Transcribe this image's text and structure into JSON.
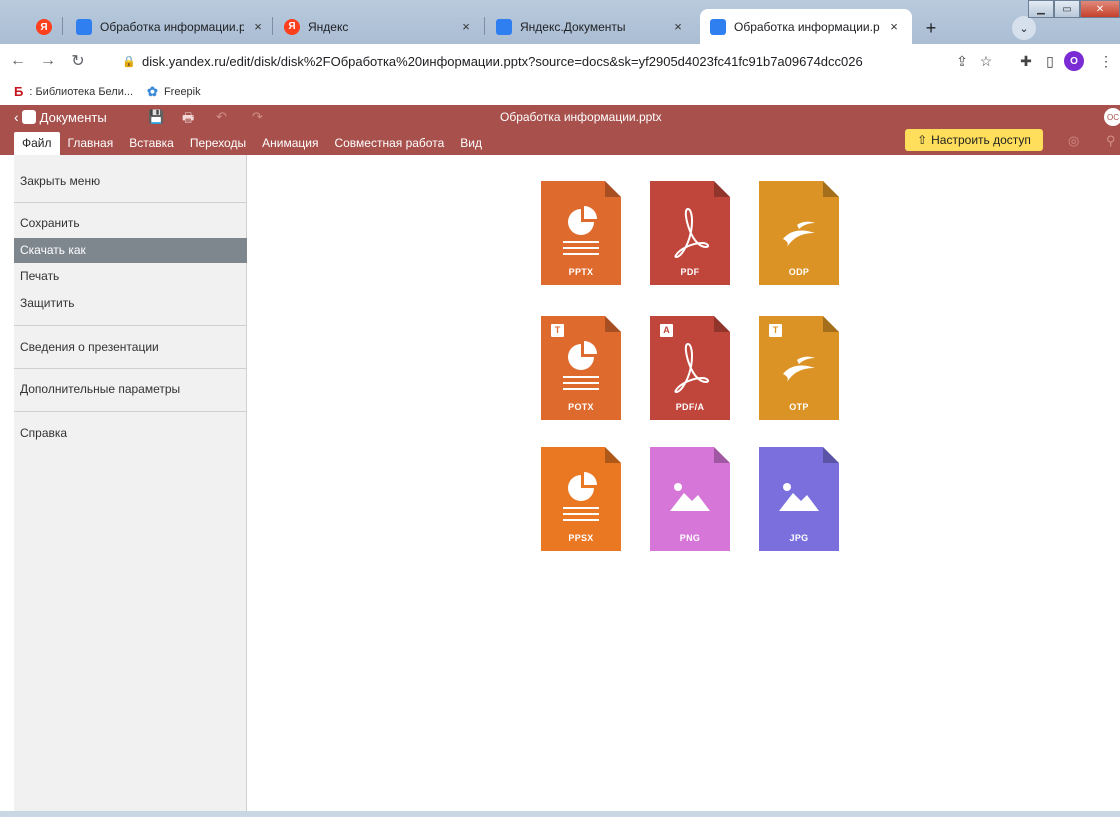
{
  "browser": {
    "tabs": [
      {
        "label": "Обработка информации.pptx -",
        "favicon": "yandex-docs-icon",
        "close": "×"
      },
      {
        "label": "Яндекс",
        "favicon": "yandex-icon",
        "close": "×"
      },
      {
        "label": "Яндекс.Документы",
        "favicon": "yandex-docs-icon",
        "close": "×"
      },
      {
        "label": "Обработка информации.pptx -",
        "favicon": "yandex-docs-icon",
        "close": "×"
      }
    ],
    "new_tab": "+",
    "url": "disk.yandex.ru/edit/disk/disk%2FОбработка%20информации.pptx?source=docs&sk=yf2905d4023fc41fc91b7a09674dcc026",
    "profile_letter": "O",
    "bookmarks": [
      {
        "label": ": Библиотека Бели...",
        "icon": "b"
      },
      {
        "label": "Freepik",
        "icon": "freepik"
      }
    ]
  },
  "app": {
    "back_label": "Документы",
    "doc_title": "Обработка информации.pptx",
    "user_initials": "ОС",
    "menu_tabs": [
      "Файл",
      "Главная",
      "Вставка",
      "Переходы",
      "Анимация",
      "Совместная работа",
      "Вид"
    ],
    "share_label": "Настроить доступ",
    "accent": "#a7504c",
    "share_color": "#ffde5c"
  },
  "sidebar": {
    "items": [
      {
        "label": "Закрыть меню"
      },
      {
        "label": "Сохранить"
      },
      {
        "label": "Скачать как",
        "active": true
      },
      {
        "label": "Печать"
      },
      {
        "label": "Защитить"
      },
      {
        "label": "Сведения о презентации"
      },
      {
        "label": "Дополнительные параметры"
      },
      {
        "label": "Справка"
      }
    ]
  },
  "formats": [
    {
      "label": "PPTX",
      "color": "#df6a2e",
      "icon": "presentation-icon"
    },
    {
      "label": "PDF",
      "color": "#c0463b",
      "icon": "pdf-icon"
    },
    {
      "label": "ODP",
      "color": "#dc9325",
      "icon": "openoffice-icon"
    },
    {
      "label": "POTX",
      "color": "#df6a2e",
      "icon": "presentation-icon",
      "badge": "T"
    },
    {
      "label": "PDF/A",
      "color": "#c0463b",
      "icon": "pdf-icon",
      "badge": "A"
    },
    {
      "label": "OTP",
      "color": "#dc9325",
      "icon": "openoffice-icon",
      "badge": "T"
    },
    {
      "label": "PPSX",
      "color": "#ea7722",
      "icon": "presentation-icon"
    },
    {
      "label": "PNG",
      "color": "#d776d9",
      "icon": "image-icon"
    },
    {
      "label": "JPG",
      "color": "#7a6fdd",
      "icon": "image-icon"
    }
  ]
}
